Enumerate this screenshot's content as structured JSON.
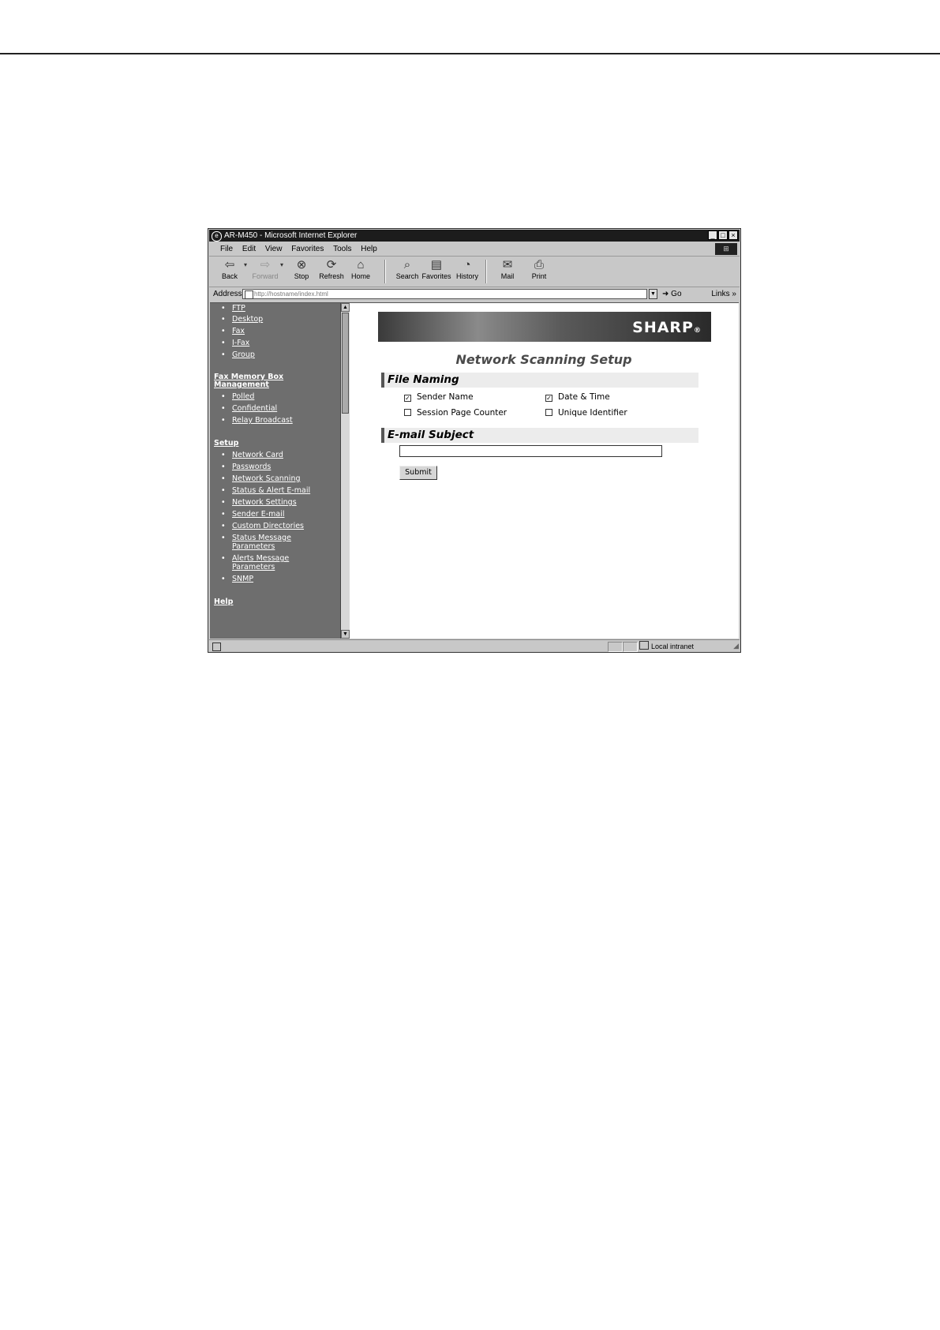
{
  "window": {
    "title": "AR-M450 - Microsoft Internet Explorer",
    "controls": [
      "_",
      "□",
      "×"
    ]
  },
  "menu": [
    "File",
    "Edit",
    "View",
    "Favorites",
    "Tools",
    "Help"
  ],
  "toolbar": {
    "back": "Back",
    "forward": "Forward",
    "stop": "Stop",
    "refresh": "Refresh",
    "home": "Home",
    "search": "Search",
    "favorites": "Favorites",
    "history": "History",
    "mail": "Mail",
    "print": "Print"
  },
  "address": {
    "label": "Address",
    "url": "http://hostname/index.html",
    "go": "Go",
    "links": "Links »"
  },
  "nav": {
    "items_top": [
      "FTP",
      "Desktop",
      "Fax",
      "I-Fax",
      "Group"
    ],
    "fax_memory": {
      "heading_line1": "Fax Memory Box",
      "heading_line2": "Management",
      "items": [
        "Polled",
        "Confidential",
        "Relay Broadcast"
      ]
    },
    "setup": {
      "heading": "Setup",
      "items": [
        "Network Card",
        "Passwords",
        "Network Scanning",
        "Status & Alert E-mail",
        "Network Settings",
        "Sender E-mail",
        "Custom Directories"
      ],
      "status_msg_1": "Status Message",
      "status_msg_2": "Parameters",
      "alerts_msg_1": "Alerts Message",
      "alerts_msg_2": "Parameters",
      "snmp": "SNMP"
    },
    "help": "Help"
  },
  "content": {
    "banner_logo": "SHARP",
    "banner_mark": "®",
    "page_title": "Network Scanning Setup",
    "file_naming": {
      "heading": "File Naming",
      "options": [
        {
          "label": "Sender Name",
          "checked": true
        },
        {
          "label": "Date & Time",
          "checked": true
        },
        {
          "label": "Session Page Counter",
          "checked": false
        },
        {
          "label": "Unique Identifier",
          "checked": false
        }
      ]
    },
    "email_subject": {
      "heading": "E-mail Subject",
      "value": ""
    },
    "submit": "Submit"
  },
  "status": {
    "zone": "Local intranet"
  }
}
